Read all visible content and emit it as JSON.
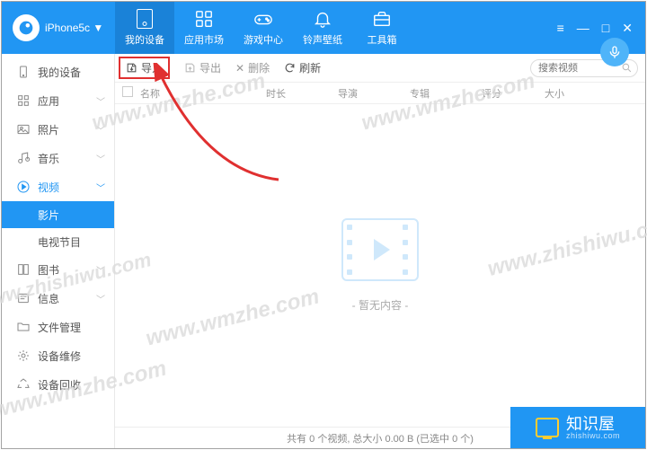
{
  "header": {
    "device": "iPhone5c ▼",
    "tabs": [
      {
        "label": "我的设备"
      },
      {
        "label": "应用市场"
      },
      {
        "label": "游戏中心"
      },
      {
        "label": "铃声壁纸"
      },
      {
        "label": "工具箱"
      }
    ]
  },
  "sidebar": {
    "items": [
      {
        "label": "我的设备",
        "icon": "device"
      },
      {
        "label": "应用",
        "icon": "apps"
      },
      {
        "label": "照片",
        "icon": "photo"
      },
      {
        "label": "音乐",
        "icon": "music"
      },
      {
        "label": "视频",
        "icon": "video",
        "active": true
      },
      {
        "label": "图书",
        "icon": "book"
      },
      {
        "label": "信息",
        "icon": "info"
      },
      {
        "label": "文件管理",
        "icon": "folder"
      },
      {
        "label": "设备维修",
        "icon": "repair"
      },
      {
        "label": "设备回收",
        "icon": "recycle"
      }
    ],
    "sub_video": [
      {
        "label": "影片"
      },
      {
        "label": "电视节目"
      }
    ]
  },
  "toolbar": {
    "import": "导入",
    "export": "导出",
    "delete": "删除",
    "refresh": "刷新",
    "search_placeholder": "搜索视频"
  },
  "table": {
    "cols": [
      "名称",
      "时长",
      "导演",
      "专辑",
      "评分",
      "大小"
    ]
  },
  "empty_text": "- 暂无内容 -",
  "status": "共有 0 个视频, 总大小 0.00 B (已选中 0 个)",
  "brand": {
    "title": "知识屋",
    "sub": "zhishiwu.com"
  },
  "watermark_a": "www.wmzhe.com",
  "watermark_b": "www.zhishiwu.com"
}
